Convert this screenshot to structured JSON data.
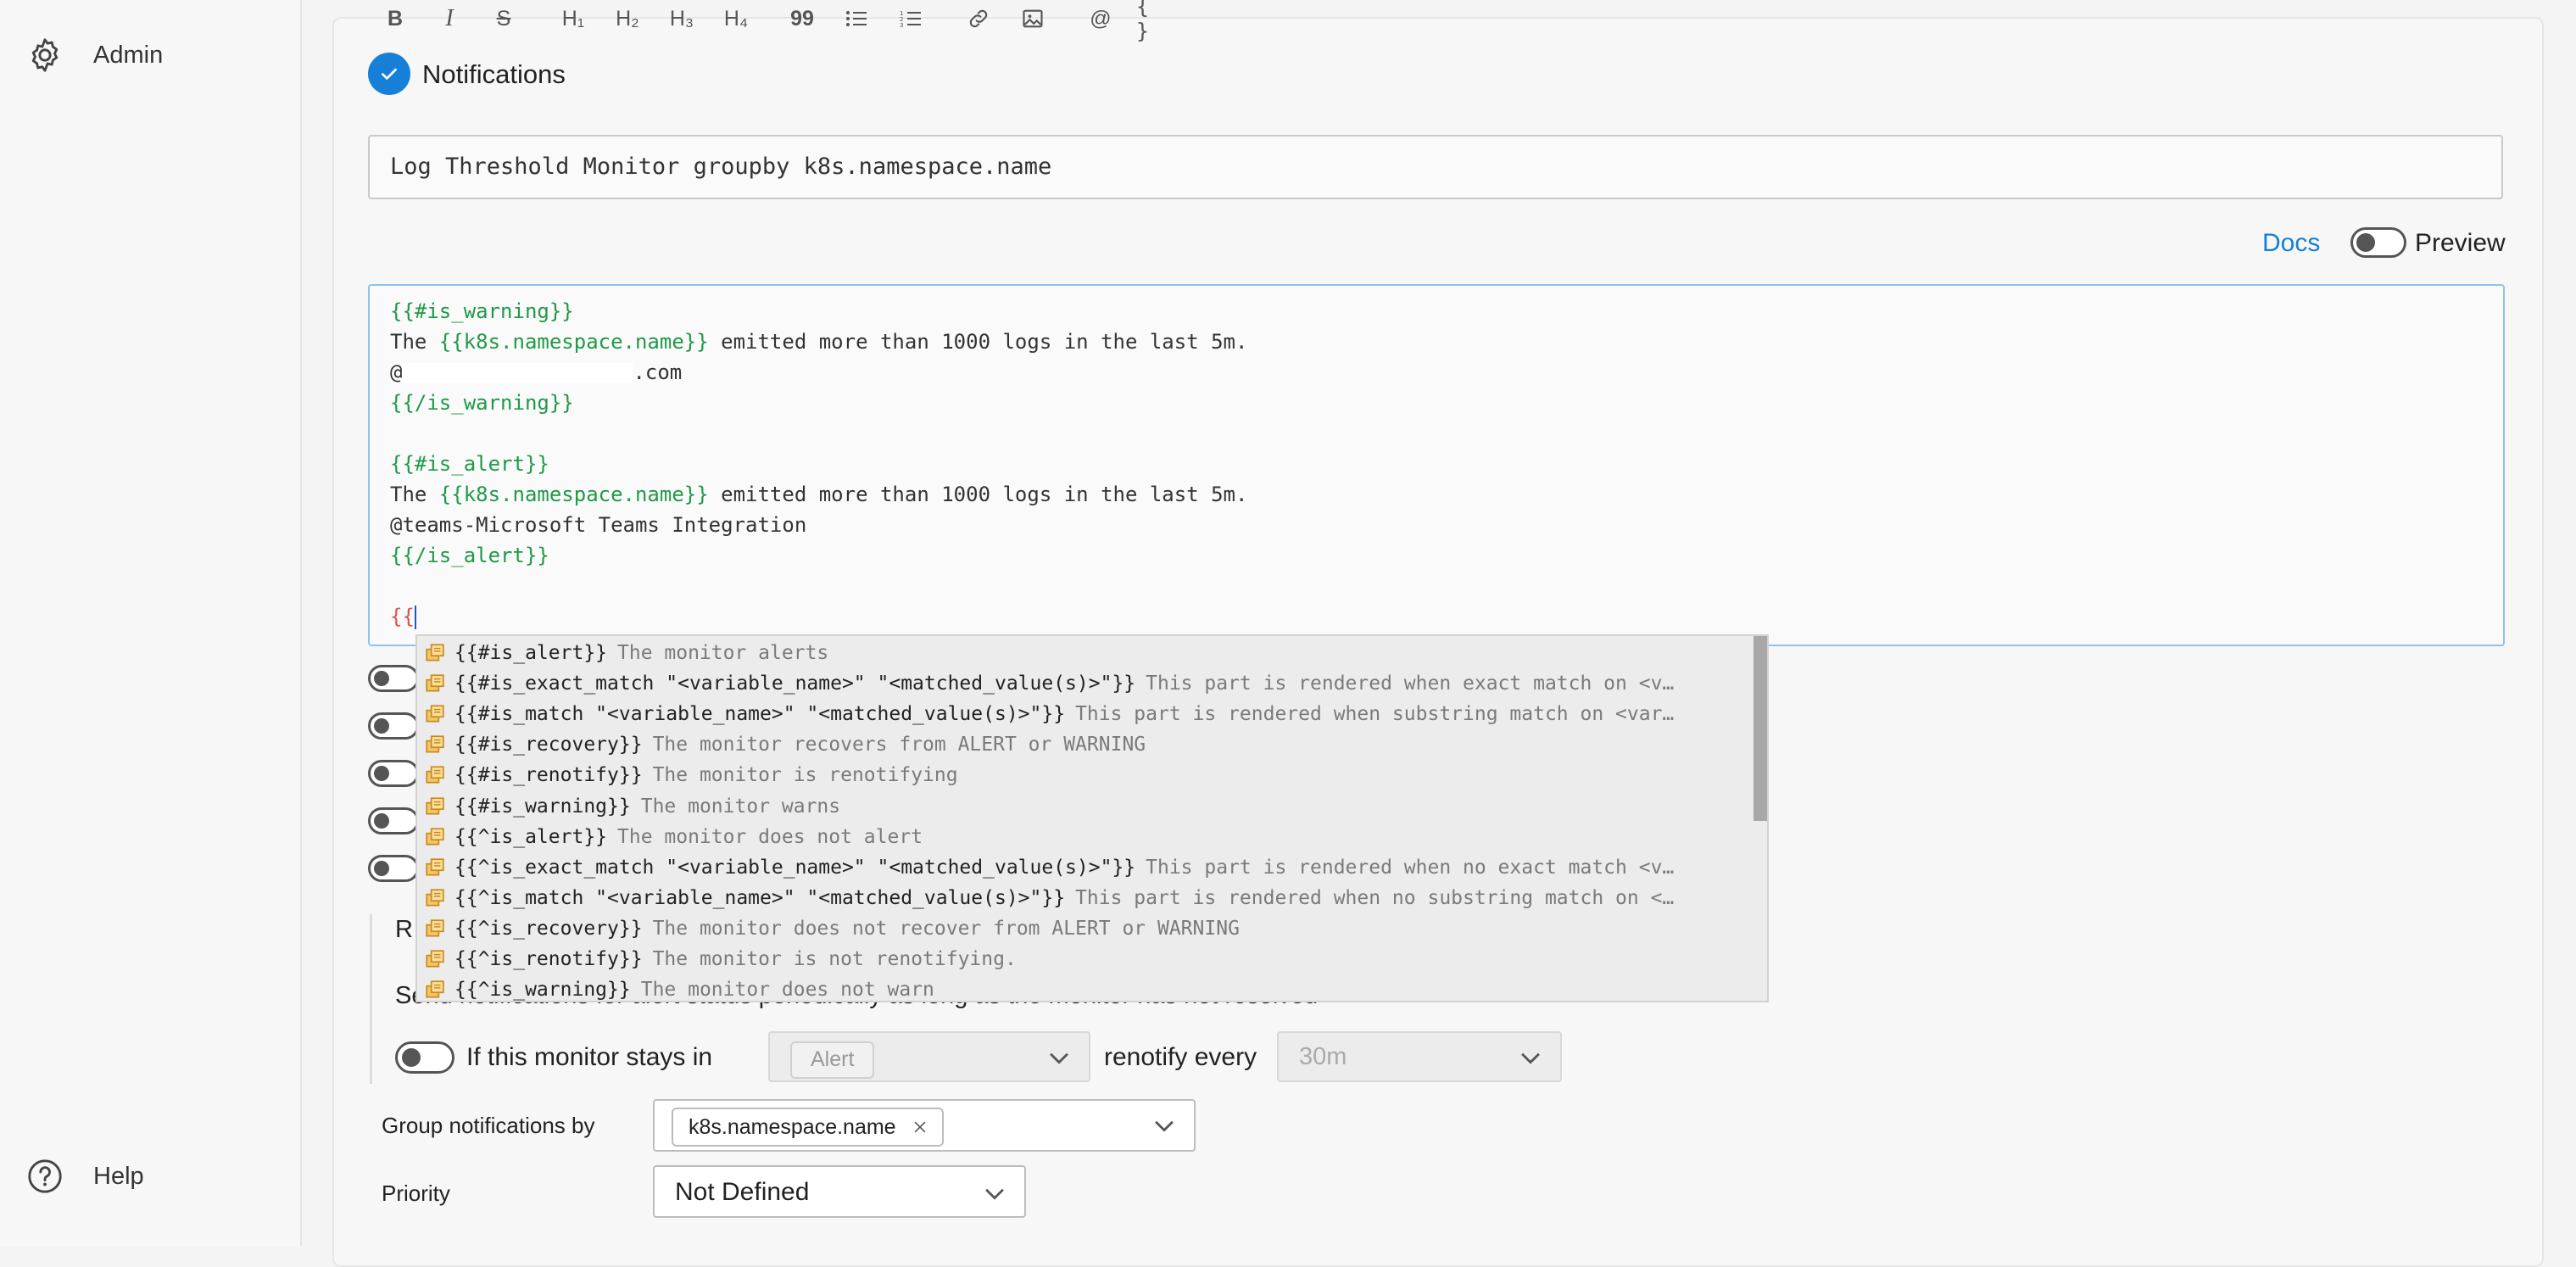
{
  "sidebar": {
    "admin_label": "Admin",
    "help_label": "Help"
  },
  "section": {
    "title": "Notifications"
  },
  "title_input": {
    "value": "Log Threshold Monitor groupby k8s.namespace.name"
  },
  "toolbar": {
    "bold": "B",
    "italic": "I",
    "strike": "S",
    "h1": "H₁",
    "h2": "H₂",
    "h3": "H₃",
    "h4": "H₄",
    "quote": "99",
    "bullets": "≔",
    "numbered": "⅓",
    "link": "🔗",
    "image": "🖼",
    "mention": "@",
    "code": "{ }",
    "docs_label": "Docs",
    "preview_label": "Preview"
  },
  "editor": {
    "l1": "{{#is_warning}}",
    "l2a": "The ",
    "l2b": "{{k8s.namespace.name}}",
    "l2c": " emitted more than 1000 logs in the last 5m.",
    "l3a": "@",
    "l3b": ".com",
    "l4": "{{/is_warning}}",
    "l6": "{{#is_alert}}",
    "l7a": "The ",
    "l7b": "{{k8s.namespace.name}}",
    "l7c": " emitted more than 1000 logs in the last 5m.",
    "l8": "@teams-Microsoft Teams Integration",
    "l9": "{{/is_alert}}",
    "l11": "{{"
  },
  "autocomplete": [
    {
      "main": "{{#is_alert}}",
      "desc": "The monitor alerts"
    },
    {
      "main": "{{#is_exact_match \"<variable_name>\" \"<matched_value(s)>\"}}",
      "desc": "This part is rendered when exact match on <v…"
    },
    {
      "main": "{{#is_match \"<variable_name>\" \"<matched_value(s)>\"}}",
      "desc": "This part is rendered when substring match on <var…"
    },
    {
      "main": "{{#is_recovery}}",
      "desc": "The monitor recovers from ALERT or WARNING"
    },
    {
      "main": "{{#is_renotify}}",
      "desc": "The monitor is renotifying"
    },
    {
      "main": "{{#is_warning}}",
      "desc": "The monitor warns"
    },
    {
      "main": "{{^is_alert}}",
      "desc": "The monitor does not alert"
    },
    {
      "main": "{{^is_exact_match \"<variable_name>\" \"<matched_value(s)>\"}}",
      "desc": "This part is rendered when no exact match <v…"
    },
    {
      "main": "{{^is_match \"<variable_name>\" \"<matched_value(s)>\"}}",
      "desc": "This part is rendered when no substring match on <…"
    },
    {
      "main": "{{^is_recovery}}",
      "desc": "The monitor does not recover from ALERT or WARNING"
    },
    {
      "main": "{{^is_renotify}}",
      "desc": "The monitor is not renotifying."
    },
    {
      "main": "{{^is_warning}}",
      "desc": "The monitor does not warn"
    }
  ],
  "renotify": {
    "heading_partial": "R",
    "desc_partial": "Send notifications for alert status periodically as long as the monitor has not resolved",
    "stays_in_label": "If this monitor stays in",
    "status_value": "Alert",
    "renotify_every_label": "renotify every",
    "interval_value": "30m"
  },
  "group_by": {
    "label": "Group notifications by",
    "tag": "k8s.namespace.name"
  },
  "priority": {
    "label": "Priority",
    "value": "Not Defined"
  },
  "colors": {
    "accent": "#1680d8",
    "template_tag": "#1f9a46",
    "open_brace": "#d9534f"
  }
}
